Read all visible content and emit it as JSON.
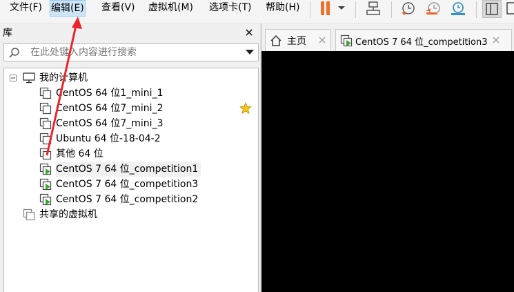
{
  "menu": {
    "file": "文件(F)",
    "edit": "编辑(E)",
    "view": "查看(V)",
    "vm": "虚拟机(M)",
    "tabs": "选项卡(T)",
    "help": "帮助(H)"
  },
  "library": {
    "title": "库",
    "search_placeholder": "在此处键入内容进行搜索",
    "root": "我的计算机",
    "items": [
      {
        "label": "CentOS 64 位1_mini_1",
        "running": false
      },
      {
        "label": "CentOS 64 位7_mini_2",
        "running": false,
        "favorite": true
      },
      {
        "label": "CentOS 64 位7_mini_3",
        "running": false
      },
      {
        "label": "Ubuntu 64 位-18-04-2",
        "running": false
      },
      {
        "label": "其他 64 位",
        "running": false
      },
      {
        "label": "CentOS 7 64 位_competition1",
        "running": true,
        "selected": true
      },
      {
        "label": "CentOS 7 64 位_competition3",
        "running": true
      },
      {
        "label": "CentOS 7 64 位_competition2",
        "running": true
      }
    ],
    "shared": "共享的虚拟机"
  },
  "tabs": {
    "home": "主页",
    "vm_tab": "CentOS 7 64 位_competition3"
  },
  "colors": {
    "pause": "#f0702a",
    "run_green": "#3aa52f",
    "star": "#f5c518",
    "arrow": "#e8262b",
    "selection": "#cce4f7"
  }
}
